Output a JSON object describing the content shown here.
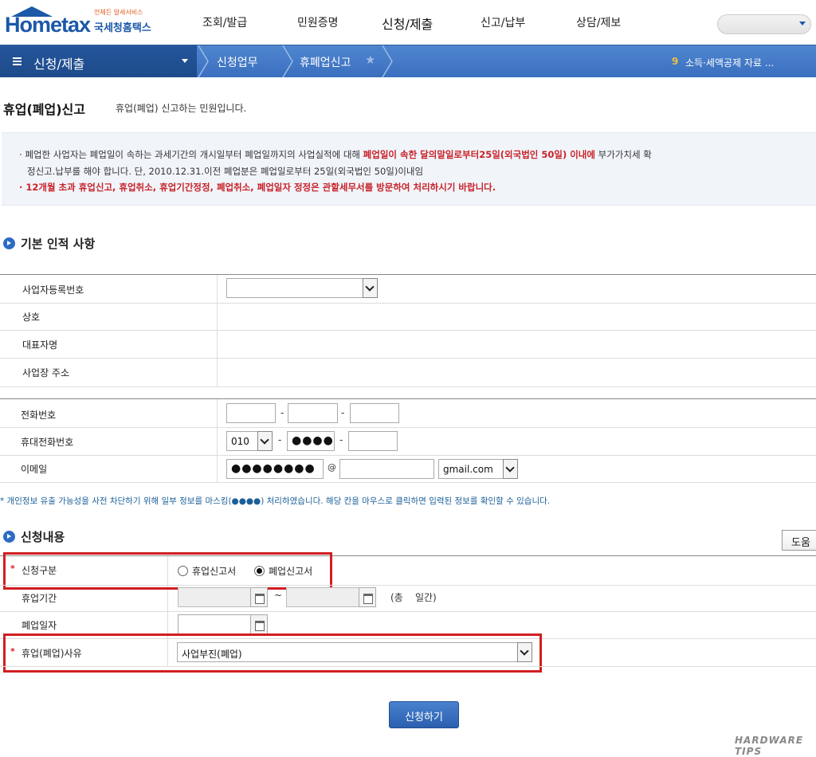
{
  "header": {
    "logo_text": "Hometax",
    "logo_sub": "국세청홈택스",
    "logo_tag": "언제든 알세서비스",
    "nav": [
      "조회/발급",
      "민원증명",
      "신청/제출",
      "신고/납부",
      "상담/제보"
    ],
    "active_nav": "신청/제출"
  },
  "subbar": {
    "menu_title": "신청/제출",
    "breadcrumbs": [
      "신청업무",
      "휴폐업신고"
    ],
    "notice_num": "9",
    "notice_text": "소득·세액공제 자료 ..."
  },
  "page": {
    "title": "휴업(폐업)신고",
    "desc": "휴업(폐업) 신고하는 민원입니다."
  },
  "info": {
    "line1_a": "폐업한 사업자는 폐업일이 속하는 과세기간의 개시일부터 폐업일까지의 사업실적에 대해",
    "line1_red": "폐업일이 속한 달의말일로부터25일(외국법인 50일) 이내에",
    "line1_b": "부가가치세 확",
    "line2": "정신고.납부를 해야 합니다. 단, 2010.12.31.이전 폐업분은 폐업일로부터 25일(외국법인 50일)이내임",
    "line3": "12개월 초과 휴업신고, 휴업취소, 휴업기간정정, 폐업취소, 폐업일자 정정은 관할세무서를 방문하여 처리하시기 바랍니다."
  },
  "basic": {
    "section_title": "기본 인적 사항",
    "labels": {
      "bizno": "사업자등록번호",
      "name": "상호",
      "rep": "대표자명",
      "addr": "사업장 주소",
      "phone": "전화번호",
      "mobile": "휴대전화번호",
      "email": "이메일"
    },
    "mobile_prefix": "010",
    "mobile_mid": "●●●●",
    "email_id": "●●●●●●●●",
    "email_at": "@",
    "email_domain_select": "gmail.com",
    "dash": "-"
  },
  "privacy_notice": "* 개인정보 유출 가능성을 사전 차단하기 위해 일부 정보를 마스킹(●●●●) 처리하였습니다. 해당 칸을 마우스로 클릭하면 입력된 정보를 확인할 수 있습니다.",
  "apply": {
    "section_title": "신청내용",
    "help_label": "도움",
    "req_mark": "*",
    "labels": {
      "type": "신청구분",
      "period": "휴업기간",
      "closedate": "폐업일자",
      "reason": "휴업(폐업)사유"
    },
    "radio_options": [
      "휴업신고서",
      "폐업신고서"
    ],
    "selected_radio": "폐업신고서",
    "tilde": "~",
    "period_total": "(총    일간)",
    "reason_value": "사업부진(폐업)"
  },
  "submit_label": "신청하기",
  "watermark": "HARDWARE TIPS",
  "colors": {
    "brand_blue": "#1b58a8",
    "nav_bar": "#3a6fbf",
    "highlight_red": "#d11e22"
  }
}
